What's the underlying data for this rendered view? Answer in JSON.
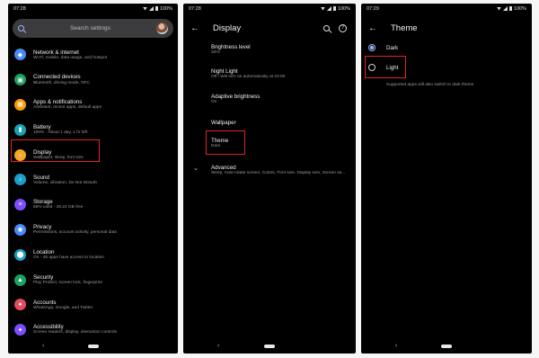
{
  "colors": {
    "accent": "#9bb4ff",
    "highlight": "#e0242a",
    "background": "#000000"
  },
  "panel_settings": {
    "status": {
      "time": "07:28",
      "battery": "100%"
    },
    "search": {
      "placeholder": "Search settings"
    },
    "items": [
      {
        "title": "Network & internet",
        "subtitle": "Wi-Fi, mobile, data usage, and hotspot",
        "icon": "wifi-icon",
        "color": "#4a8af4"
      },
      {
        "title": "Connected devices",
        "subtitle": "Bluetooth, driving mode, NFC",
        "icon": "devices-icon",
        "color": "#1aa260"
      },
      {
        "title": "Apps & notifications",
        "subtitle": "Assistant, recent apps, default apps",
        "icon": "apps-icon",
        "color": "#f59b00"
      },
      {
        "title": "Battery",
        "subtitle": "100% · About 1 day, 1 hr left",
        "icon": "battery-icon",
        "color": "#17a2b8"
      },
      {
        "title": "Display",
        "subtitle": "Wallpaper, sleep, font size",
        "icon": "brightness-icon",
        "color": "#f5a623"
      },
      {
        "title": "Sound",
        "subtitle": "Volume, vibration, Do Not Disturb",
        "icon": "volume-icon",
        "color": "#1aa0c8"
      },
      {
        "title": "Storage",
        "subtitle": "56% used - 28.24 GB free",
        "icon": "storage-icon",
        "color": "#7c4dff"
      },
      {
        "title": "Privacy",
        "subtitle": "Permissions, account activity, personal data",
        "icon": "privacy-icon",
        "color": "#4a8af4"
      },
      {
        "title": "Location",
        "subtitle": "On - 46 apps have access to location",
        "icon": "location-icon",
        "color": "#1aa0c8"
      },
      {
        "title": "Security",
        "subtitle": "Play Protect, screen lock, fingerprint",
        "icon": "lock-icon",
        "color": "#1aa260"
      },
      {
        "title": "Accounts",
        "subtitle": "WhatsApp, Google, and Twitter",
        "icon": "accounts-icon",
        "color": "#e84a5f"
      },
      {
        "title": "Accessibility",
        "subtitle": "Screen readers, display, interaction controls",
        "icon": "accessibility-icon",
        "color": "#7c4dff"
      }
    ]
  },
  "panel_display": {
    "status": {
      "time": "07:28",
      "battery": "100%"
    },
    "title": "Display",
    "items": [
      {
        "title": "Brightness level",
        "subtitle": "20%"
      },
      {
        "title": "Night Light",
        "subtitle": "Off / Will turn on automatically at 22:00"
      },
      {
        "title": "Adaptive brightness",
        "subtitle": "On"
      },
      {
        "title": "Wallpaper",
        "subtitle": ""
      },
      {
        "title": "Theme",
        "subtitle": "Dark"
      },
      {
        "title": "Advanced",
        "subtitle": "Sleep, Auto-rotate screen, Colors, Font size, Display size, Screen sa..."
      }
    ]
  },
  "panel_theme": {
    "status": {
      "time": "07:29",
      "battery": "100%"
    },
    "title": "Theme",
    "options": [
      {
        "label": "Dark",
        "selected": true
      },
      {
        "label": "Light",
        "selected": false
      }
    ],
    "note": "Supported apps will also switch to dark theme"
  }
}
